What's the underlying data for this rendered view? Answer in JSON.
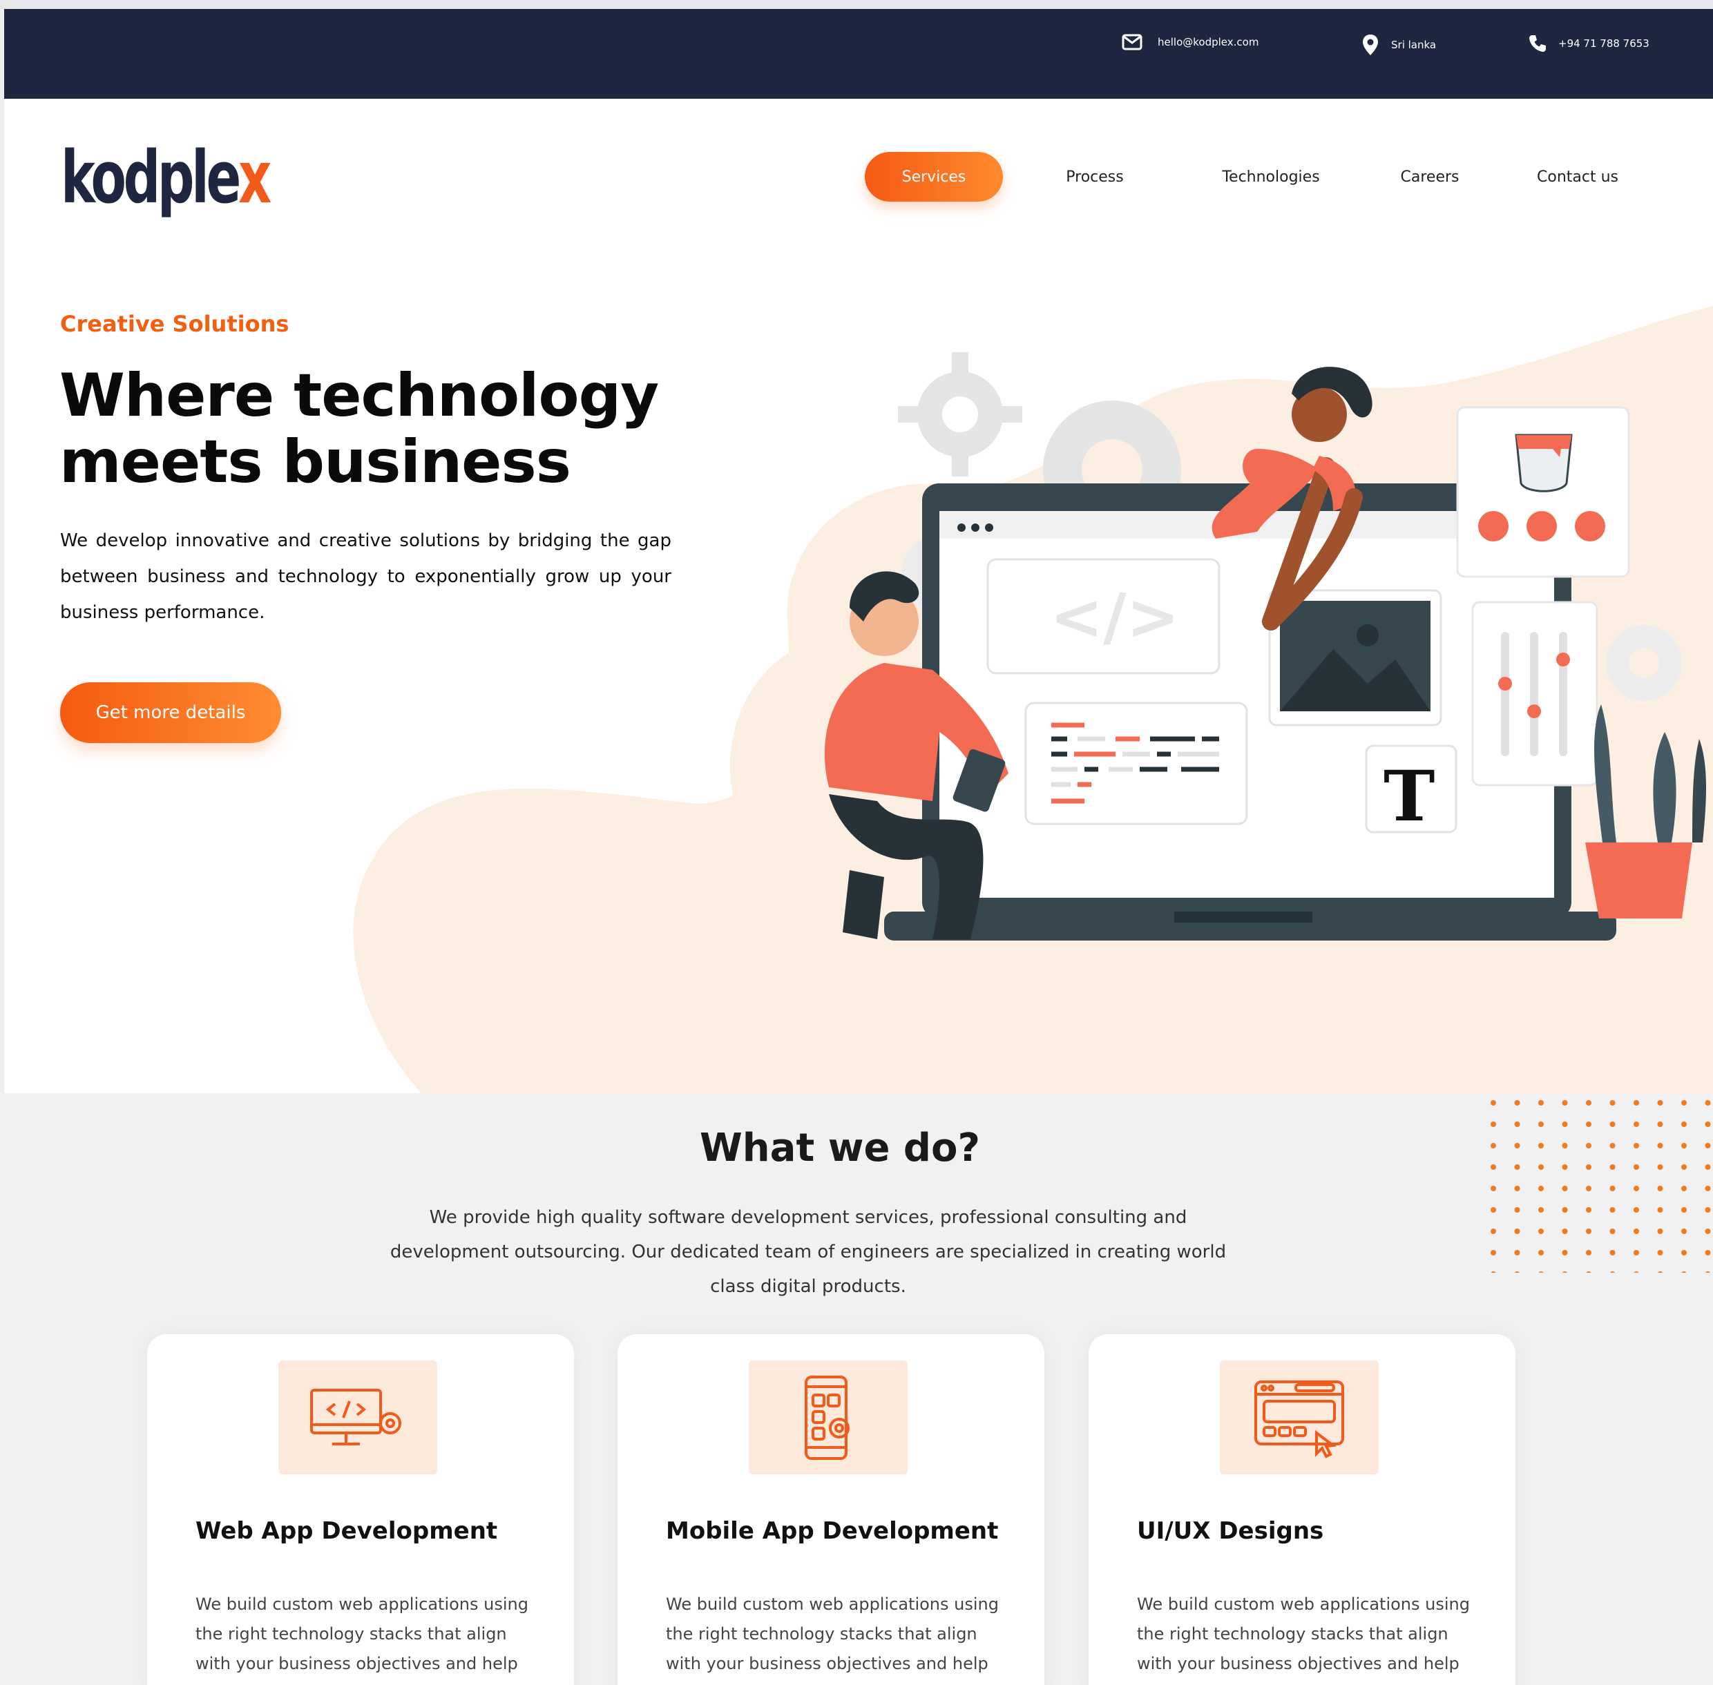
{
  "topbar": {
    "email": "hello@kodplex.com",
    "location": "Sri lanka",
    "phone": "+94  71 788 7653"
  },
  "brand": {
    "logo_main": "kodple",
    "logo_accent": "x",
    "accent_color": "#f25a1a",
    "dark_color": "#1f2640"
  },
  "nav": {
    "items": [
      {
        "label": "Services",
        "active": true
      },
      {
        "label": "Process"
      },
      {
        "label": "Technologies"
      },
      {
        "label": "Careers"
      },
      {
        "label": "Contact us"
      }
    ]
  },
  "hero": {
    "eyebrow": "Creative Solutions",
    "title_line1": "Where technology",
    "title_line2": "meets business",
    "description": "We develop innovative and creative solutions by bridging the gap between business and technology to exponentially grow up your business performance.",
    "cta_label": "Get more details"
  },
  "services_section": {
    "title": "What we do?",
    "description": "We provide high quality software development services, professional consulting and development outsourcing. Our dedicated team of engineers are specialized in creating world class digital products.",
    "cards": [
      {
        "icon": "web-code-monitor-icon",
        "title": "Web App Development",
        "text": "We build custom web applications using the right technology stacks that align with your business objectives and help you achieve maximum growth."
      },
      {
        "icon": "mobile-app-icon",
        "title": "Mobile App Development",
        "text": "We build custom web applications using the right technology stacks that align with your business objectives and help you achieve maximum growth."
      },
      {
        "icon": "ui-ux-design-icon",
        "title": "UI/UX Designs",
        "text": "We build custom web applications using the right technology stacks that align with your business objectives and help you achieve maximum growth."
      }
    ]
  }
}
